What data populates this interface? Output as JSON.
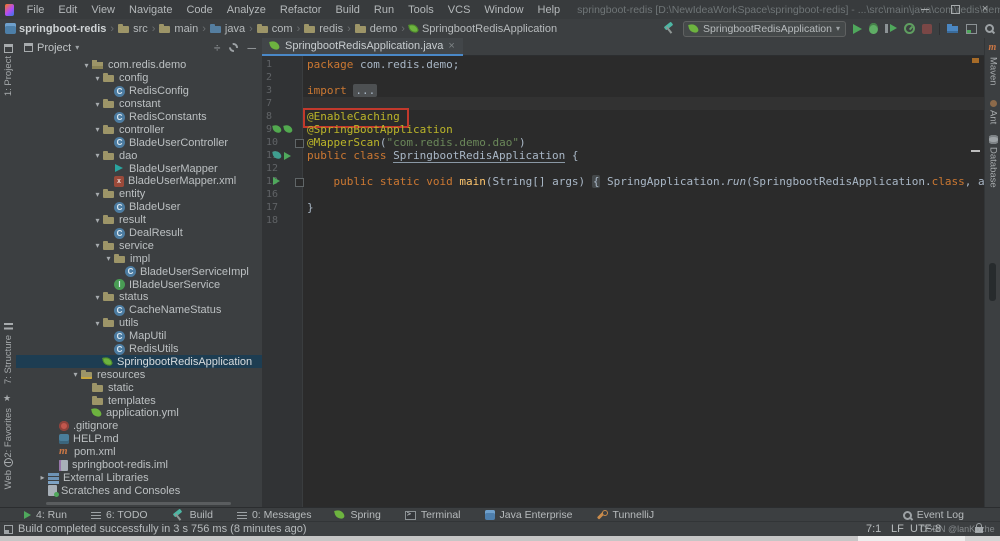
{
  "colors": {
    "accent_blue": "#4a88c7",
    "spring_green": "#6db33f",
    "keyword_orange": "#cc7832",
    "annotation_yellow": "#bbb529",
    "string_green": "#6a8759",
    "editor_bg": "#2b2b2b",
    "panel_bg": "#3c3f41",
    "selection_bg": "#1d3d52",
    "highlight_red": "#c3392c"
  },
  "window": {
    "menu_items": [
      "File",
      "Edit",
      "View",
      "Navigate",
      "Code",
      "Analyze",
      "Refactor",
      "Build",
      "Run",
      "Tools",
      "VCS",
      "Window",
      "Help"
    ],
    "title": "springboot-redis [D:\\NewIdeaWorkSpace\\springboot-redis] - ...\\src\\main\\java\\com\\redis\\demo\\SpringbootRedisApplication.java"
  },
  "breadcrumbs": {
    "items": [
      {
        "label": "springboot-redis",
        "icon": "project-sq"
      },
      {
        "label": "src",
        "icon": "folder"
      },
      {
        "label": "main",
        "icon": "folder"
      },
      {
        "label": "java",
        "icon": "folder-blue"
      },
      {
        "label": "com",
        "icon": "folder"
      },
      {
        "label": "redis",
        "icon": "folder"
      },
      {
        "label": "demo",
        "icon": "folder"
      },
      {
        "label": "SpringbootRedisApplication",
        "icon": "spring"
      }
    ]
  },
  "toolbar": {
    "run_config_label": "SpringbootRedisApplication"
  },
  "left_stripe": {
    "items": [
      {
        "label": "1: Project",
        "icon": "project"
      },
      {
        "label": "7: Structure",
        "icon": "structure"
      },
      {
        "label": "2: Favorites",
        "icon": "star"
      },
      {
        "label": "Web",
        "icon": "web"
      }
    ]
  },
  "right_stripe": {
    "items": [
      {
        "label": "Maven",
        "icon": "maven"
      },
      {
        "label": "Ant",
        "icon": "ant"
      },
      {
        "label": "Database",
        "icon": "db"
      }
    ]
  },
  "project_panel": {
    "title": "Project",
    "tree": [
      {
        "label": "com.redis.demo",
        "icon": "package",
        "level": 5,
        "arrow": "down"
      },
      {
        "label": "config",
        "icon": "folder",
        "level": 6,
        "arrow": "down"
      },
      {
        "label": "RedisConfig",
        "icon": "class",
        "level": 7
      },
      {
        "label": "constant",
        "icon": "folder",
        "level": 6,
        "arrow": "down"
      },
      {
        "label": "RedisConstants",
        "icon": "class",
        "level": 7
      },
      {
        "label": "controller",
        "icon": "folder",
        "level": 6,
        "arrow": "down"
      },
      {
        "label": "BladeUserController",
        "icon": "class",
        "level": 7
      },
      {
        "label": "dao",
        "icon": "folder",
        "level": 6,
        "arrow": "down"
      },
      {
        "label": "BladeUserMapper",
        "icon": "mapper",
        "level": 7
      },
      {
        "label": "BladeUserMapper.xml",
        "icon": "xml",
        "level": 7
      },
      {
        "label": "entity",
        "icon": "folder",
        "level": 6,
        "arrow": "down"
      },
      {
        "label": "BladeUser",
        "icon": "class",
        "level": 7
      },
      {
        "label": "result",
        "icon": "folder",
        "level": 6,
        "arrow": "down"
      },
      {
        "label": "DealResult",
        "icon": "class",
        "level": 7
      },
      {
        "label": "service",
        "icon": "folder",
        "level": 6,
        "arrow": "down"
      },
      {
        "label": "impl",
        "icon": "folder",
        "level": 7,
        "arrow": "down"
      },
      {
        "label": "BladeUserServiceImpl",
        "icon": "class",
        "level": 8
      },
      {
        "label": "IBladeUserService",
        "icon": "iface",
        "level": 7
      },
      {
        "label": "status",
        "icon": "folder",
        "level": 6,
        "arrow": "down"
      },
      {
        "label": "CacheNameStatus",
        "icon": "class",
        "level": 7
      },
      {
        "label": "utils",
        "icon": "folder",
        "level": 6,
        "arrow": "down"
      },
      {
        "label": "MapUtil",
        "icon": "class",
        "level": 7
      },
      {
        "label": "RedisUtils",
        "icon": "class",
        "level": 7
      },
      {
        "label": "SpringbootRedisApplication",
        "icon": "spring",
        "level": 6,
        "selected": true
      },
      {
        "label": "resources",
        "icon": "resources",
        "level": 4,
        "arrow": "down"
      },
      {
        "label": "static",
        "icon": "folder",
        "level": 5
      },
      {
        "label": "templates",
        "icon": "folder",
        "level": 5
      },
      {
        "label": "application.yml",
        "icon": "leaf",
        "level": 5
      },
      {
        "label": ".gitignore",
        "icon": "git",
        "level": 2
      },
      {
        "label": "HELP.md",
        "icon": "md",
        "level": 2
      },
      {
        "label": "pom.xml",
        "icon": "maven",
        "level": 2
      },
      {
        "label": "springboot-redis.iml",
        "icon": "iml",
        "level": 2
      },
      {
        "label": "External Libraries",
        "icon": "lib",
        "level": 1,
        "arrow": "right"
      },
      {
        "label": "Scratches and Consoles",
        "icon": "scratch",
        "level": 1
      }
    ]
  },
  "editor": {
    "tab": {
      "label": "SpringbootRedisApplication.java"
    },
    "lines": [
      {
        "num": "1",
        "tokens": [
          [
            "kw",
            "package"
          ],
          [
            "pl",
            " com.redis.demo;"
          ]
        ]
      },
      {
        "num": "2",
        "tokens": []
      },
      {
        "num": "3",
        "tokens": [
          [
            "kw",
            "import"
          ],
          [
            "pl",
            " "
          ],
          [
            "fold",
            "..."
          ]
        ]
      },
      {
        "num": "7",
        "tokens": [],
        "caret": true
      },
      {
        "num": "8",
        "tokens": [
          [
            "ann",
            "@EnableCaching"
          ]
        ],
        "redbox": true
      },
      {
        "num": "9",
        "tokens": [
          [
            "ann",
            "@SpringBootApplication"
          ]
        ],
        "gutter": [
          "leafg",
          "leafg"
        ]
      },
      {
        "num": "10",
        "tokens": [
          [
            "ann",
            "@MapperScan"
          ],
          [
            "pl",
            "("
          ],
          [
            "str",
            "\"com.redis.demo.dao\""
          ],
          [
            "pl",
            ")"
          ]
        ],
        "foldbox": true
      },
      {
        "num": "11",
        "tokens": [
          [
            "kw",
            "public class "
          ],
          [
            "cls",
            "SpringbootRedisApplication"
          ],
          [
            "pl",
            " {"
          ]
        ],
        "gutter": [
          "bean",
          "play"
        ]
      },
      {
        "num": "12",
        "tokens": []
      },
      {
        "num": "13",
        "tokens": [
          [
            "pl",
            "    "
          ],
          [
            "kw",
            "public static void "
          ],
          [
            "meth",
            "main"
          ],
          [
            "pl",
            "(String[] args) "
          ],
          [
            "foldbr",
            "{"
          ],
          [
            "pl",
            " SpringApplication."
          ],
          [
            "it",
            "run"
          ],
          [
            "pl",
            "(SpringbootRedisApplication."
          ],
          [
            "kw",
            "class"
          ],
          [
            "pl",
            ", args); "
          ],
          [
            "foldbr",
            "}"
          ]
        ],
        "gutter": [
          "play"
        ],
        "foldbox": true
      },
      {
        "num": "16",
        "tokens": []
      },
      {
        "num": "17",
        "tokens": [
          [
            "pl",
            "}"
          ]
        ]
      },
      {
        "num": "18",
        "tokens": []
      }
    ]
  },
  "bottom_bar": {
    "items": [
      {
        "label": "4: Run",
        "icon": "play"
      },
      {
        "label": "6: TODO",
        "icon": "todo"
      },
      {
        "label": "Build",
        "icon": "hammer"
      },
      {
        "label": "0: Messages",
        "icon": "messages"
      },
      {
        "label": "Spring",
        "icon": "leaf"
      },
      {
        "label": "Terminal",
        "icon": "terminal"
      },
      {
        "label": "Java Enterprise",
        "icon": "javaee"
      },
      {
        "label": "TunnelliJ",
        "icon": "wrench"
      }
    ],
    "right": {
      "label": "Event Log"
    }
  },
  "status_bar": {
    "message": "Build completed successfully in 3 s 756 ms (8 minutes ago)",
    "position": "7:1",
    "line_sep": "LF",
    "encoding": "UTF-8",
    "watermark": "CSDN @lanKozhe"
  }
}
